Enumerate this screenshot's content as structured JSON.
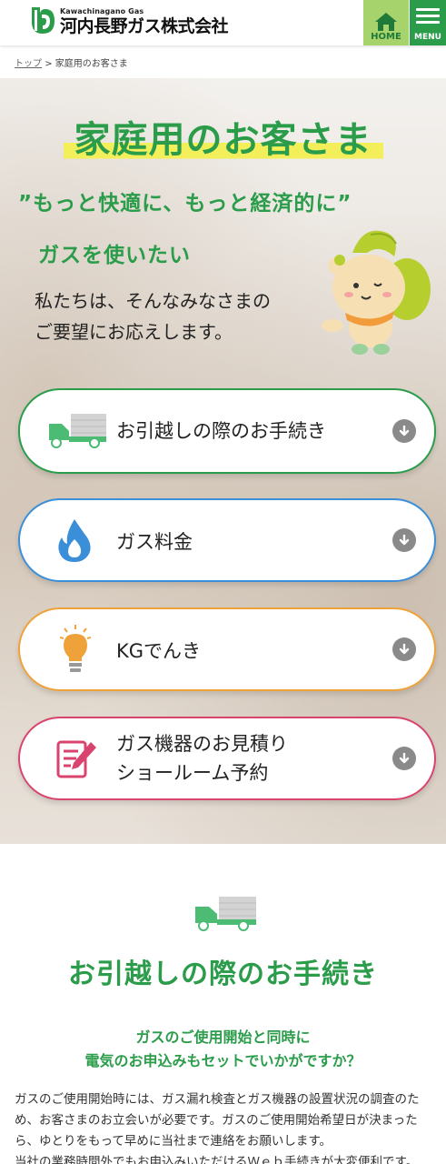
{
  "header": {
    "logo_sub": "Kawachinagano Gas",
    "logo_main": "河内長野ガス株式会社",
    "home_label": "HOME",
    "menu_label": "MENU"
  },
  "breadcrumb": {
    "home": "トップ",
    "separator": ">",
    "current": "家庭用のお客さま"
  },
  "hero": {
    "title": "家庭用のお客さま",
    "catch_line1": "”もっと快適に、もっと経済的に”",
    "catch_line2": "ガスを使いたい",
    "desc_line1": "私たちは、そんなみなさまの",
    "desc_line2": "ご要望にお応えします。"
  },
  "services": [
    {
      "label": "お引越しの際のお手続き",
      "icon": "moving-truck-icon",
      "color": "#2a9c4a"
    },
    {
      "label": "ガス料金",
      "icon": "gas-flame-icon",
      "color": "#3a8fd8"
    },
    {
      "label": "KGでんき",
      "icon": "light-bulb-icon",
      "color": "#f0a23a"
    },
    {
      "label_line1": "ガス機器のお見積り",
      "label_line2": "ショールーム予約",
      "icon": "estimate-document-icon",
      "color": "#d9446e"
    }
  ],
  "moving_section": {
    "title": "お引越しの際のお手続き",
    "lead_line1": "ガスのご使用開始と同時に",
    "lead_line2": "電気のお申込みもセットでいかがですか？",
    "body_line1": "ガスのご使用開始時には、ガス漏れ検査とガス機器の設置状況の調査のた",
    "body_line2": "め、お客さまのお立会いが必要です。ガスのご使用開始希望日が決まった",
    "body_line3": "ら、ゆとりをもって早めに当社まで連絡をお願いします。",
    "body_line4": "当社の業務時間外でもお申込みいただけるＷｅｂ手続きが大変便利です。"
  },
  "colors": {
    "brand_green": "#2a9c4a",
    "home_green": "#a6d36b",
    "highlight_yellow": "#f3ef5a"
  }
}
